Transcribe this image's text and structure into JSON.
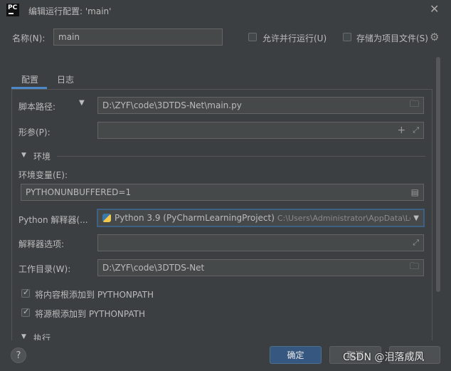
{
  "window": {
    "title": "编辑运行配置: 'main'",
    "logo_text": "PC"
  },
  "header": {
    "name_label": "名称(N):",
    "name_value": "main",
    "allow_parallel_label": "允许并行运行(U)",
    "allow_parallel_checked": false,
    "store_as_file_label": "存储为项目文件(S)",
    "store_as_file_checked": false
  },
  "tabs": [
    {
      "label": "配置",
      "active": true
    },
    {
      "label": "日志",
      "active": false
    }
  ],
  "config": {
    "script_path_label": "脚本路径:",
    "script_path_value": "D:\\ZYF\\code\\3DTDS-Net\\main.py",
    "params_label": "形参(P):",
    "params_value": "",
    "env_section_label": "环境",
    "env_vars_label": "环境变量(E):",
    "env_vars_value": "PYTHONUNBUFFERED=1",
    "interpreter_label": "Python 解释器(...",
    "interpreter_name": "Python 3.9 (PyCharmLearningProject)",
    "interpreter_path": "C:\\Users\\Administrator\\AppData\\Loc",
    "interpreter_options_label": "解释器选项:",
    "interpreter_options_value": "",
    "workdir_label": "工作目录(W):",
    "workdir_value": "D:\\ZYF\\code\\3DTDS-Net",
    "add_content_roots_label": "将内容根添加到 PYTHONPATH",
    "add_content_roots_checked": true,
    "add_source_roots_label": "将源根添加到 PYTHONPATH",
    "add_source_roots_checked": true,
    "exec_section_label": "执行"
  },
  "footer": {
    "help_label": "?",
    "ok_label": "确定",
    "cancel_label": "取消",
    "apply_label": "应用"
  },
  "watermark": "CSDN @泪落成风",
  "colors": {
    "accent": "#4a88c7",
    "primary_button": "#365880",
    "background": "#3c3f41",
    "field": "#45494a"
  }
}
